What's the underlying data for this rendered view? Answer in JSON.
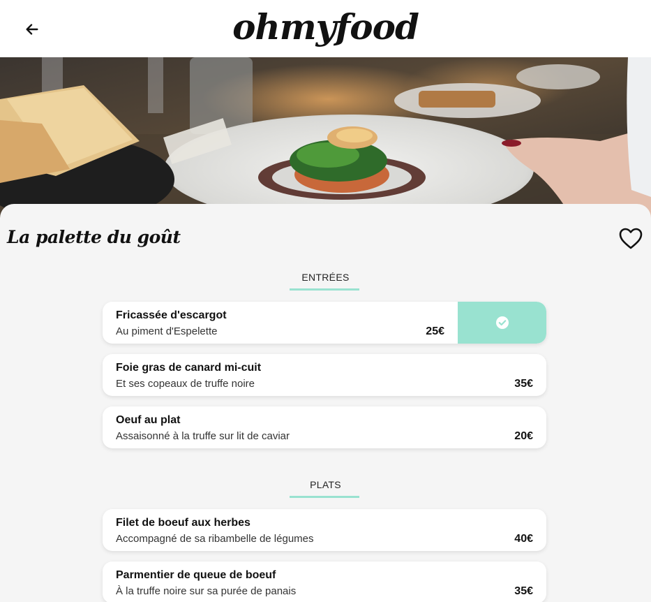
{
  "header": {
    "logo": "ohmyfood",
    "back_icon": "arrow-left-icon"
  },
  "hero": {
    "image": "restaurant-dish-photo"
  },
  "restaurant": {
    "name": "La palette du goût",
    "favorite_icon": "heart-outline-icon"
  },
  "sections": [
    {
      "title": "ENTRÉES",
      "dishes": [
        {
          "name": "Fricassée d'escargot",
          "description": "Au piment d'Espelette",
          "price": "25€",
          "selected": true,
          "check_icon": "check-circle-icon"
        },
        {
          "name": "Foie gras de canard mi-cuit",
          "description": "Et ses copeaux de truffe noire",
          "price": "35€",
          "selected": false
        },
        {
          "name": "Oeuf au plat",
          "description": "Assaisonné à la truffe sur lit de caviar",
          "price": "20€",
          "selected": false
        }
      ]
    },
    {
      "title": "PLATS",
      "dishes": [
        {
          "name": "Filet de boeuf aux herbes",
          "description": "Accompagné de sa ribambelle de légumes",
          "price": "40€",
          "selected": false
        },
        {
          "name": "Parmentier de queue de boeuf",
          "description": "À la truffe noire sur sa purée de panais",
          "price": "35€",
          "selected": false
        }
      ]
    }
  ],
  "colors": {
    "accent": "#99e2d0",
    "background": "#f5f5f5",
    "card": "#ffffff",
    "text": "#111111"
  }
}
